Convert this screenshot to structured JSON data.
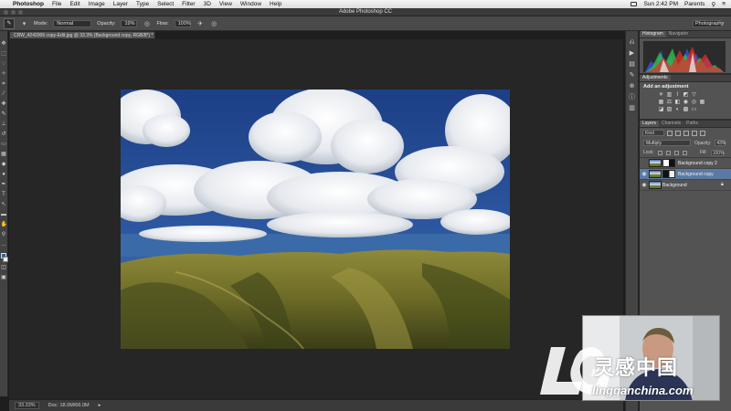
{
  "menubar": {
    "app_name": "Photoshop",
    "menus": [
      "File",
      "Edit",
      "Image",
      "Layer",
      "Type",
      "Select",
      "Filter",
      "3D",
      "View",
      "Window",
      "Help"
    ],
    "clock": "Sun 2:42 PM",
    "user": "Parents"
  },
  "window": {
    "title": "Adobe Photoshop CC"
  },
  "options_bar": {
    "mode_label": "Mode:",
    "mode_value": "Normal",
    "opacity_label": "Opacity:",
    "opacity_value": "19%",
    "flow_label": "Flow:",
    "flow_value": "100%",
    "workspace": "Photography"
  },
  "document": {
    "tab_label": "CRW_4242006 copy-Edit.jpg @ 33.3% (Background copy, RGB/8*) *"
  },
  "status": {
    "zoom": "33.33%",
    "doc_size": "Doc: 18.0M/66.0M"
  },
  "panels": {
    "histogram_tabs": [
      "Histogram",
      "Navigator"
    ],
    "adjustments_tab": "Adjustments",
    "adjustments_title": "Add an adjustment",
    "layers_tabs": [
      "Layers",
      "Channels",
      "Paths"
    ],
    "kind_label": "Kind",
    "blend_mode": "Multiply",
    "opacity_label": "Opacity:",
    "opacity_value": "43%",
    "lock_label": "Lock:",
    "fill_label": "Fill:",
    "fill_value": "100%",
    "layers": [
      {
        "name": "Background copy 2",
        "selected": false
      },
      {
        "name": "Background copy",
        "selected": true
      },
      {
        "name": "Background",
        "selected": false
      }
    ]
  },
  "watermark": {
    "chinese": "灵感中国",
    "site": "lingganchina.com"
  },
  "colors": {
    "accent_selection": "#5a7aa4",
    "panel_bg": "#535353",
    "canvas_bg": "#262626"
  }
}
